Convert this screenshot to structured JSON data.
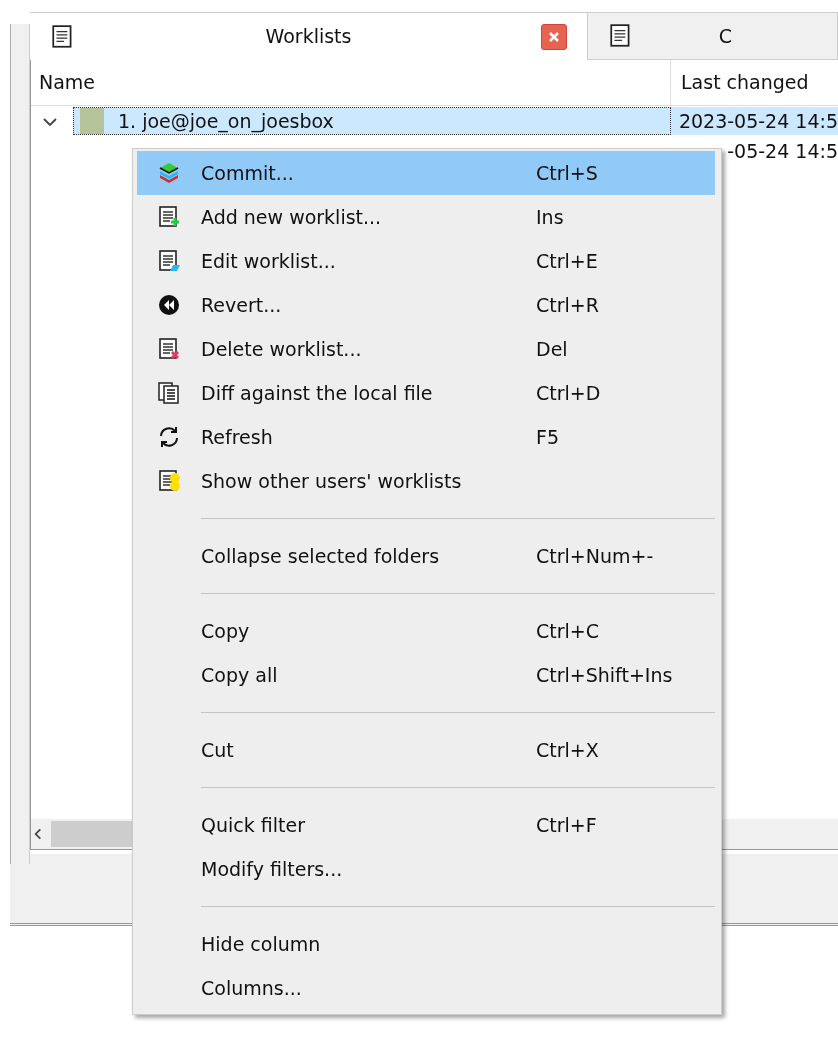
{
  "tabs": [
    {
      "label": "Worklists",
      "selected": true,
      "closable": true
    },
    {
      "label": "C",
      "selected": false,
      "closable": false
    }
  ],
  "table": {
    "columns": [
      "Name",
      "Last changed"
    ],
    "rows": [
      {
        "name": "1. joe@joe_on_joesbox",
        "date": "2023-05-24 14:5",
        "expanded": true,
        "selected": true
      },
      {
        "date": "-05-24 14:5",
        "selected": false
      }
    ]
  },
  "context_menu": {
    "items": [
      {
        "kind": "item",
        "label": "Commit...",
        "shortcut": "Ctrl+S",
        "selected": true
      },
      {
        "kind": "item",
        "label": "Add new worklist...",
        "shortcut": "Ins",
        "selected": false
      },
      {
        "kind": "item",
        "label": "Edit worklist...",
        "shortcut": "Ctrl+E",
        "selected": false
      },
      {
        "kind": "item",
        "label": "Revert...",
        "shortcut": "Ctrl+R",
        "selected": false
      },
      {
        "kind": "item",
        "label": "Delete worklist...",
        "shortcut": "Del",
        "selected": false
      },
      {
        "kind": "item",
        "label": "Diff against the local file",
        "shortcut": "Ctrl+D",
        "selected": false
      },
      {
        "kind": "item",
        "label": "Refresh",
        "shortcut": "F5",
        "selected": false
      },
      {
        "kind": "item",
        "label": "Show other users' worklists",
        "selected": false
      },
      {
        "kind": "separator"
      },
      {
        "kind": "item",
        "label": "Collapse selected folders",
        "shortcut": "Ctrl+Num+-",
        "selected": false
      },
      {
        "kind": "separator"
      },
      {
        "kind": "item",
        "label": "Copy",
        "shortcut": "Ctrl+C",
        "selected": false
      },
      {
        "kind": "item",
        "label": "Copy all",
        "shortcut": "Ctrl+Shift+Ins",
        "selected": false
      },
      {
        "kind": "separator"
      },
      {
        "kind": "item",
        "label": "Cut",
        "shortcut": "Ctrl+X",
        "selected": false
      },
      {
        "kind": "separator"
      },
      {
        "kind": "item",
        "label": "Quick filter",
        "shortcut": "Ctrl+F",
        "selected": false
      },
      {
        "kind": "item",
        "label": "Modify filters...",
        "selected": false
      },
      {
        "kind": "separator"
      },
      {
        "kind": "item",
        "label": "Hide column",
        "selected": false
      },
      {
        "kind": "item",
        "label": "Columns...",
        "selected": false
      }
    ]
  }
}
